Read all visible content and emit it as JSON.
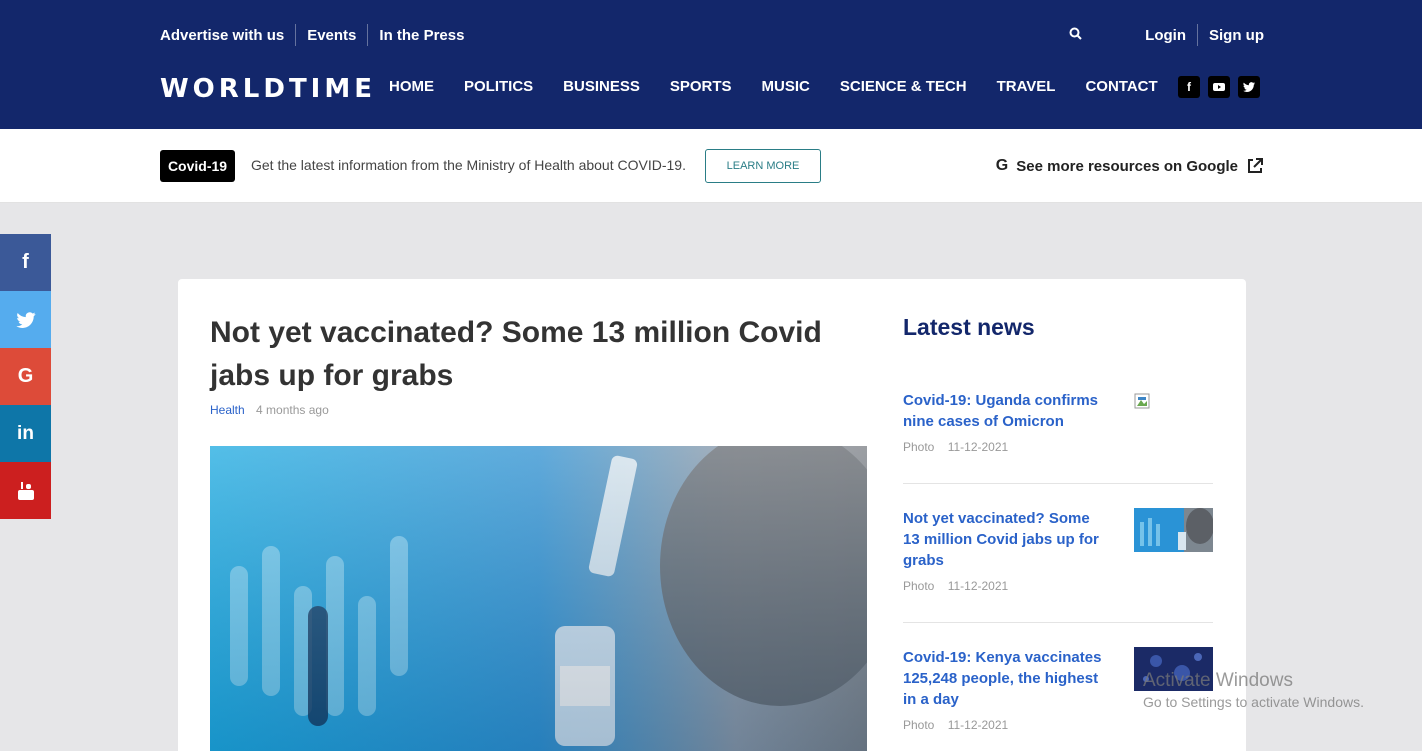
{
  "header": {
    "top_links": [
      "Advertise with us",
      "Events",
      "In the Press"
    ],
    "auth": {
      "login": "Login",
      "signup": "Sign up"
    },
    "logo": "WORLDTIME",
    "nav": [
      "HOME",
      "POLITICS",
      "BUSINESS",
      "SPORTS",
      "MUSIC",
      "SCIENCE & TECH",
      "TRAVEL",
      "CONTACT"
    ],
    "social_icons": [
      "facebook-icon",
      "youtube-icon",
      "twitter-icon"
    ],
    "background_color": "#13276b"
  },
  "covid_bar": {
    "badge": "Covid-19",
    "text": "Get the latest information from the Ministry of Health about COVID-19.",
    "button": "LEARN MORE",
    "google_link": "See more resources on Google"
  },
  "share_bar": {
    "items": [
      {
        "icon": "facebook-icon",
        "color": "#3b5998"
      },
      {
        "icon": "twitter-icon",
        "color": "#55acee"
      },
      {
        "icon": "google-icon",
        "color": "#dd4b39"
      },
      {
        "icon": "linkedin-icon",
        "color": "#0e76a8"
      },
      {
        "icon": "youtube-icon",
        "color": "#cc1f1f"
      }
    ]
  },
  "article": {
    "title": "Not yet vaccinated? Some 13 million Covid jabs up for grabs",
    "category": "Health",
    "time": "4 months ago"
  },
  "latest_news": {
    "heading": "Latest news",
    "items": [
      {
        "headline": "Covid-19: Uganda confirms nine cases of Omicron",
        "type": "Photo",
        "date": "11-12-2021"
      },
      {
        "headline": "Not yet vaccinated? Some 13 million Covid jabs up for grabs",
        "type": "Photo",
        "date": "11-12-2021"
      },
      {
        "headline": "Covid-19: Kenya vaccinates 125,248 people, the highest in a day",
        "type": "Photo",
        "date": "11-12-2021"
      }
    ]
  },
  "watermark": {
    "line1": "Activate Windows",
    "line2": "Go to Settings to activate Windows."
  }
}
